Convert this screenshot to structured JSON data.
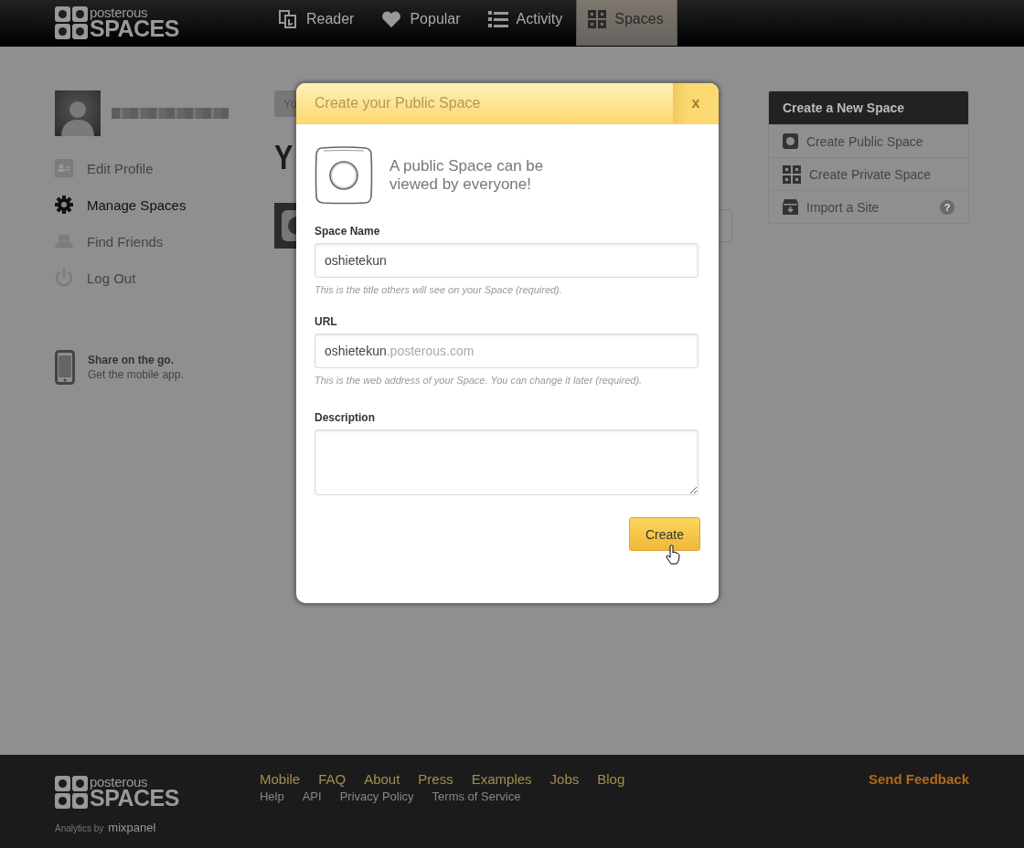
{
  "nav": {
    "logo": {
      "top": "posterous",
      "bottom": "SPACES"
    },
    "items": [
      {
        "label": "Reader",
        "kind": "reader",
        "selected": false
      },
      {
        "label": "Popular",
        "kind": "heart",
        "selected": false
      },
      {
        "label": "Activity",
        "kind": "list",
        "selected": false
      },
      {
        "label": "Spaces",
        "kind": "grid",
        "selected": true
      }
    ]
  },
  "sidebar": {
    "menu": [
      {
        "label": "Edit Profile",
        "kind": "card",
        "selected": false
      },
      {
        "label": "Manage Spaces",
        "kind": "gear",
        "selected": true
      },
      {
        "label": "Find Friends",
        "kind": "people",
        "selected": false
      },
      {
        "label": "Log Out",
        "kind": "power",
        "selected": false
      }
    ],
    "mobile": {
      "title": "Share on the go.",
      "subtitle": "Get the mobile app."
    }
  },
  "main": {
    "tab_chip": "Yo",
    "heading": "Y"
  },
  "create_panel": {
    "title": "Create a New Space",
    "items": [
      {
        "label": "Create Public Space",
        "kind": "public"
      },
      {
        "label": "Create Private Space",
        "kind": "grid"
      },
      {
        "label": "Import a Site",
        "kind": "import",
        "help": "?"
      }
    ]
  },
  "modal": {
    "title": "Create your Public Space",
    "close": "x",
    "intro": "A public Space can be viewed by everyone!",
    "fields": [
      {
        "kind": "text",
        "label": "Space Name",
        "value": "oshietekun",
        "hint": "This is the title others will see on your Space (required)."
      },
      {
        "kind": "url",
        "label": "URL",
        "value": "oshietekun",
        "suffix": ".posterous.com",
        "hint": "This is the web address of your Space. You can change it later (required)."
      },
      {
        "kind": "textarea",
        "label": "Description"
      }
    ],
    "submit": "Create"
  },
  "footer": {
    "logo": {
      "top": "posterous",
      "bottom": "SPACES"
    },
    "links": [
      "Mobile",
      "FAQ",
      "About",
      "Press",
      "Examples",
      "Jobs",
      "Blog"
    ],
    "links_secondary": [
      "Help",
      "API",
      "Privacy Policy",
      "Terms of Service"
    ],
    "feedback": "Send Feedback",
    "analytics": {
      "label": "Analytics by",
      "brand": "mixpanel"
    }
  }
}
